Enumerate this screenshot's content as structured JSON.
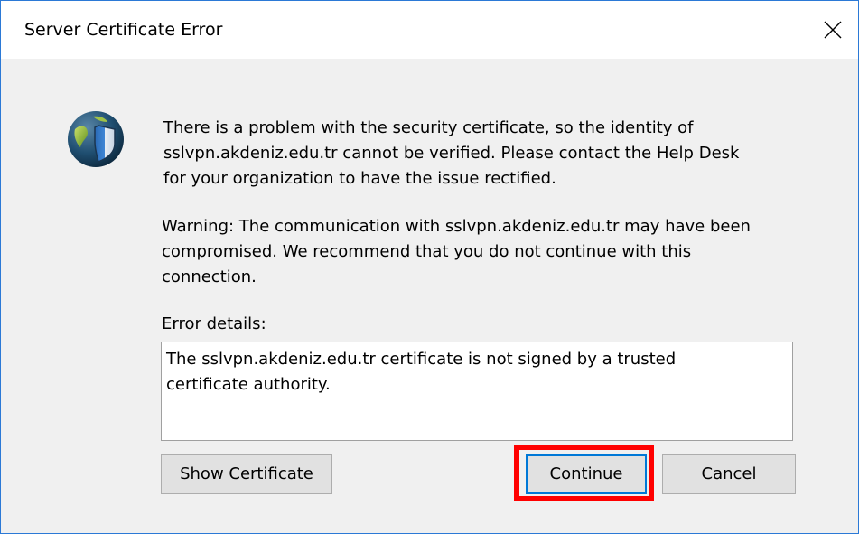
{
  "dialog": {
    "title": "Server Certificate Error",
    "icon": "shield-globe-icon",
    "message_lines": [
      "There is a problem with the security certificate, so the identity of",
      "sslvpn.akdeniz.edu.tr cannot be verified. Please contact the Help Desk",
      "for your organization to have the issue rectified."
    ],
    "warning_lines": [
      "Warning: The communication with sslvpn.akdeniz.edu.tr may have been",
      "compromised. We recommend that you do not continue with this",
      "connection."
    ],
    "details_label": "Error details:",
    "details_lines": [
      "The sslvpn.akdeniz.edu.tr certificate is not signed by a trusted",
      "certificate authority."
    ]
  },
  "buttons": {
    "show_certificate": "Show Certificate",
    "continue": "Continue",
    "cancel": "Cancel"
  },
  "colors": {
    "highlight": "#ff0000",
    "window_border": "#2b79d6",
    "focus_border": "#0078d7"
  }
}
